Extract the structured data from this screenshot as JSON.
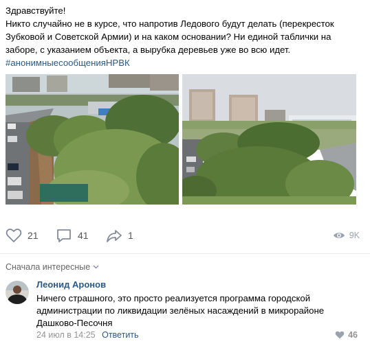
{
  "post": {
    "lines": [
      "Здравствуйте!",
      "Никто случайно не в курсе, что напротив Ледового будут делать (перекресток",
      "Зубковой и Советской Армии) и на каком основании? Ни единой таблички на",
      "заборе, с указанием объекта, а вырубка деревьев уже во всю идет."
    ],
    "hashtag": "#анонимныесообщенияНРВК"
  },
  "photos": [
    {
      "subject": "construction site fence with trees, apartment buildings in background"
    },
    {
      "subject": "two high-rise buildings, arena, trees and road"
    }
  ],
  "actions": {
    "likes": "21",
    "comments": "41",
    "shares": "1",
    "views": "9K"
  },
  "comments_section": {
    "sort_label": "Сначала интересные"
  },
  "comment": {
    "author": "Леонид Аронов",
    "lines": [
      "Ничего страшного, это просто реализуется программа городской",
      "администрации по ликвидации зелёных насаждений в микрорайоне",
      "Дашково-Песочня"
    ],
    "date": "24 июл в 14:25",
    "reply_label": "Ответить",
    "likes": "46"
  },
  "colors": {
    "link": "#2a5885",
    "muted": "#939393",
    "icon": "#99a2ad"
  }
}
